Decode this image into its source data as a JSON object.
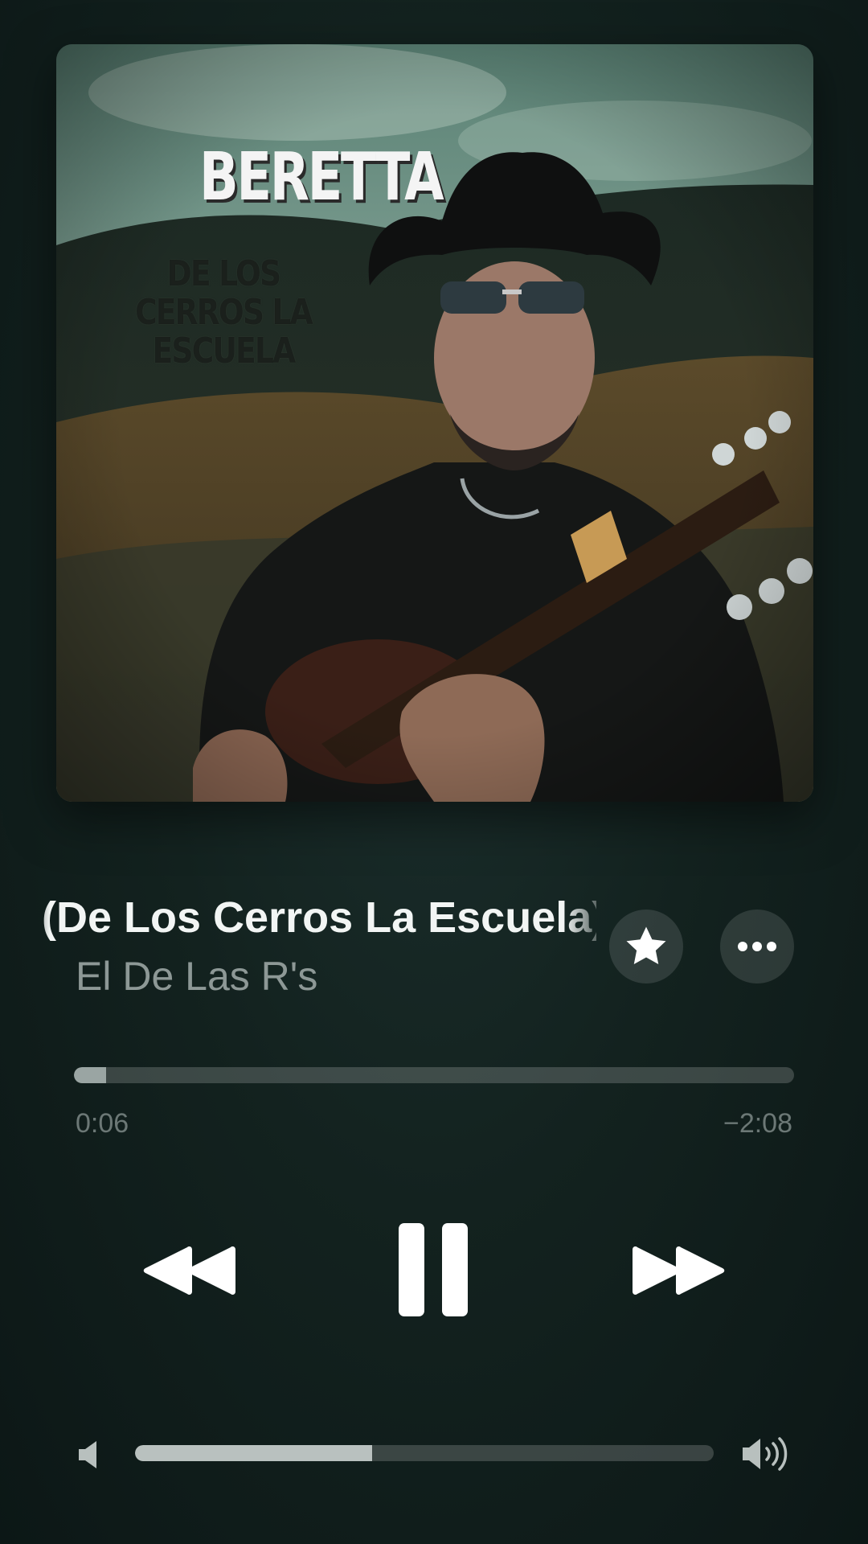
{
  "artwork": {
    "title": "BERETTA",
    "subtitle": "DE LOS CERROS LA ESCUELA"
  },
  "track": {
    "title": "(De Los Cerros La Escuela)",
    "artist": "El De Las R's"
  },
  "playback": {
    "elapsed": "0:06",
    "remaining": "−2:08",
    "progress_fraction": 0.045,
    "state": "playing"
  },
  "volume": {
    "level_fraction": 0.41
  },
  "icons": {
    "favorite": "star-icon",
    "more": "ellipsis-icon",
    "rewind": "rewind-icon",
    "pause": "pause-icon",
    "forward": "fast-forward-icon",
    "volume_low": "speaker-low-icon",
    "volume_high": "speaker-high-icon"
  },
  "colors": {
    "background": "#13221f",
    "primary_text": "#f2f5f4",
    "secondary_text": "#8d9896",
    "progress_fill": "#9aa5a3"
  }
}
